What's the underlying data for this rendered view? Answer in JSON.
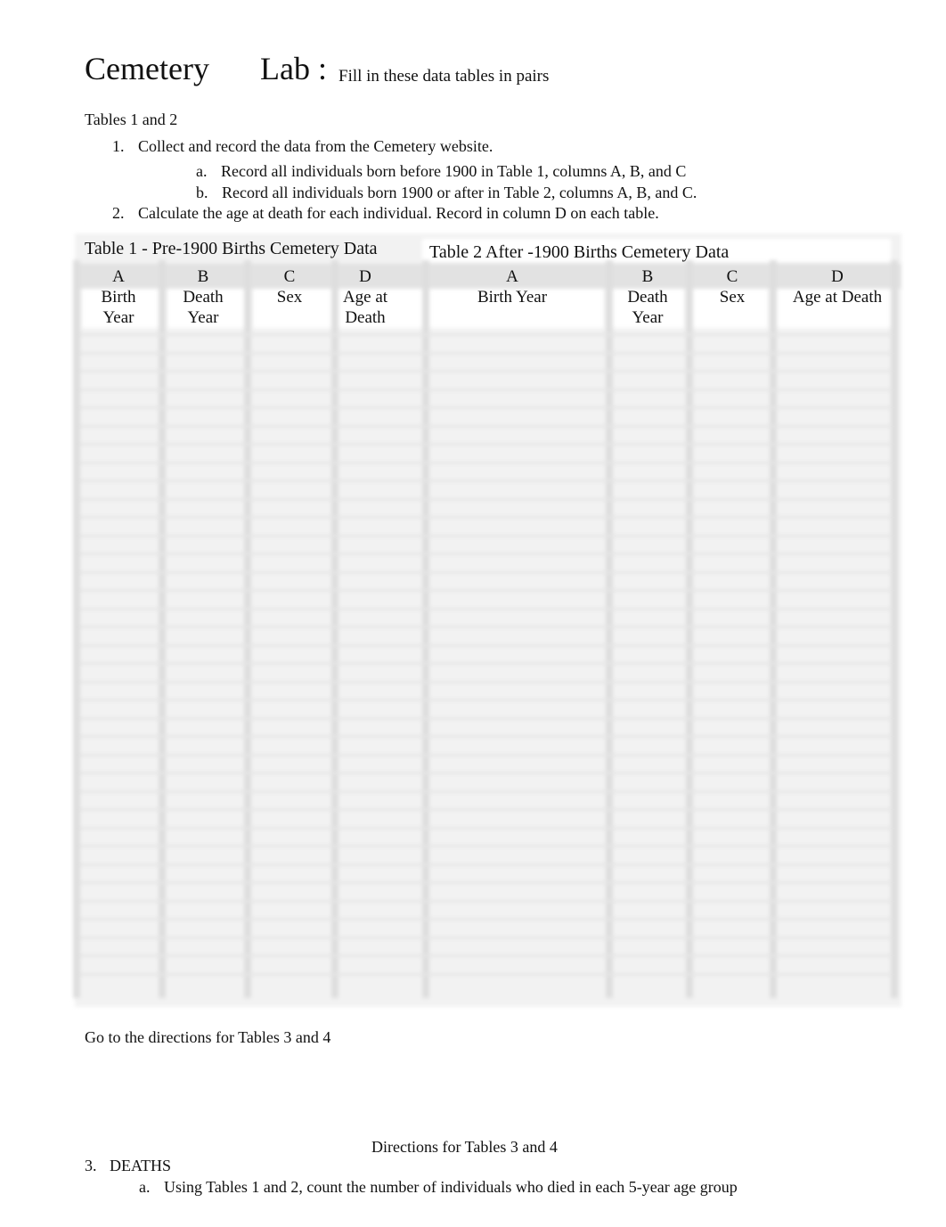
{
  "header": {
    "title_word1": "Cemetery",
    "title_word2": "Lab :",
    "subtitle": "Fill in these data tables in pairs"
  },
  "section_label": "Tables 1 and 2",
  "instructions": [
    {
      "num": "1.",
      "text": "Collect and record the data from the Cemetery website."
    },
    {
      "num": "a.",
      "text": "Record all individuals born before 1900 in Table 1, columns A, B, and C"
    },
    {
      "num": "b.",
      "text": "Record all individuals born 1900 or after  in Table 2, columns A, B, and C."
    },
    {
      "num": "2.",
      "text": "Calculate the age at death for each individual. Record in column D on each table."
    }
  ],
  "table1": {
    "title": "Table 1 - Pre-1900 Births Cemetery Data",
    "columns": [
      {
        "letter": "A",
        "line1": "Birth",
        "line2": "Year"
      },
      {
        "letter": "B",
        "line1": "Death",
        "line2": "Year"
      },
      {
        "letter": "C",
        "line1": "Sex",
        "line2": ""
      },
      {
        "letter": "D",
        "line1": "Age at",
        "line2": "Death"
      }
    ]
  },
  "table2": {
    "title": "Table 2 After -1900 Births Cemetery Data",
    "columns": [
      {
        "letter": "A",
        "line1": "Birth Year",
        "line2": ""
      },
      {
        "letter": "B",
        "line1": "Death",
        "line2": "Year"
      },
      {
        "letter": "C",
        "line1": "Sex",
        "line2": ""
      },
      {
        "letter": "D",
        "line1": "Age at Death",
        "line2": ""
      }
    ]
  },
  "footer_note": "Go to the directions for Tables 3 and 4",
  "directions_heading": "Directions for Tables 3 and 4",
  "deaths": {
    "num": "3.",
    "label": "DEATHS"
  },
  "deaths_step": {
    "num": "a.",
    "text": "Using Tables 1 and 2, count the number of individuals who died in each 5-year age group"
  }
}
